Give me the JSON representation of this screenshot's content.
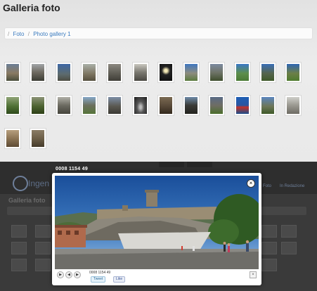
{
  "page": {
    "title": "Galleria foto",
    "breadcrumb": [
      "Foto",
      "Photo gallery 1"
    ]
  },
  "thumbnails": [
    {
      "name": "photo-1"
    },
    {
      "name": "photo-2"
    },
    {
      "name": "photo-3"
    },
    {
      "name": "photo-4"
    },
    {
      "name": "photo-5"
    },
    {
      "name": "photo-6"
    },
    {
      "name": "photo-7"
    },
    {
      "name": "photo-8"
    },
    {
      "name": "photo-9"
    },
    {
      "name": "photo-10"
    },
    {
      "name": "photo-11"
    },
    {
      "name": "photo-12"
    },
    {
      "name": "photo-13"
    },
    {
      "name": "photo-14"
    },
    {
      "name": "photo-15"
    },
    {
      "name": "photo-16"
    },
    {
      "name": "photo-17"
    },
    {
      "name": "photo-18"
    },
    {
      "name": "photo-19"
    },
    {
      "name": "photo-20"
    },
    {
      "name": "photo-21"
    },
    {
      "name": "photo-22"
    },
    {
      "name": "photo-23"
    },
    {
      "name": "photo-24"
    },
    {
      "name": "photo-25"
    },
    {
      "name": "photo-26"
    }
  ],
  "background_page": {
    "logo_text": "Ingen",
    "title": "Galleria foto",
    "nav_items": [
      "Foto",
      "In Redazione"
    ]
  },
  "lightbox": {
    "counter": "0008 1154 49",
    "caption": "0008 1154 49",
    "tweet_label": "Tweet",
    "like_label": "Like",
    "close_symbol": "×",
    "controls": [
      "▶",
      "◀",
      "▶"
    ]
  }
}
